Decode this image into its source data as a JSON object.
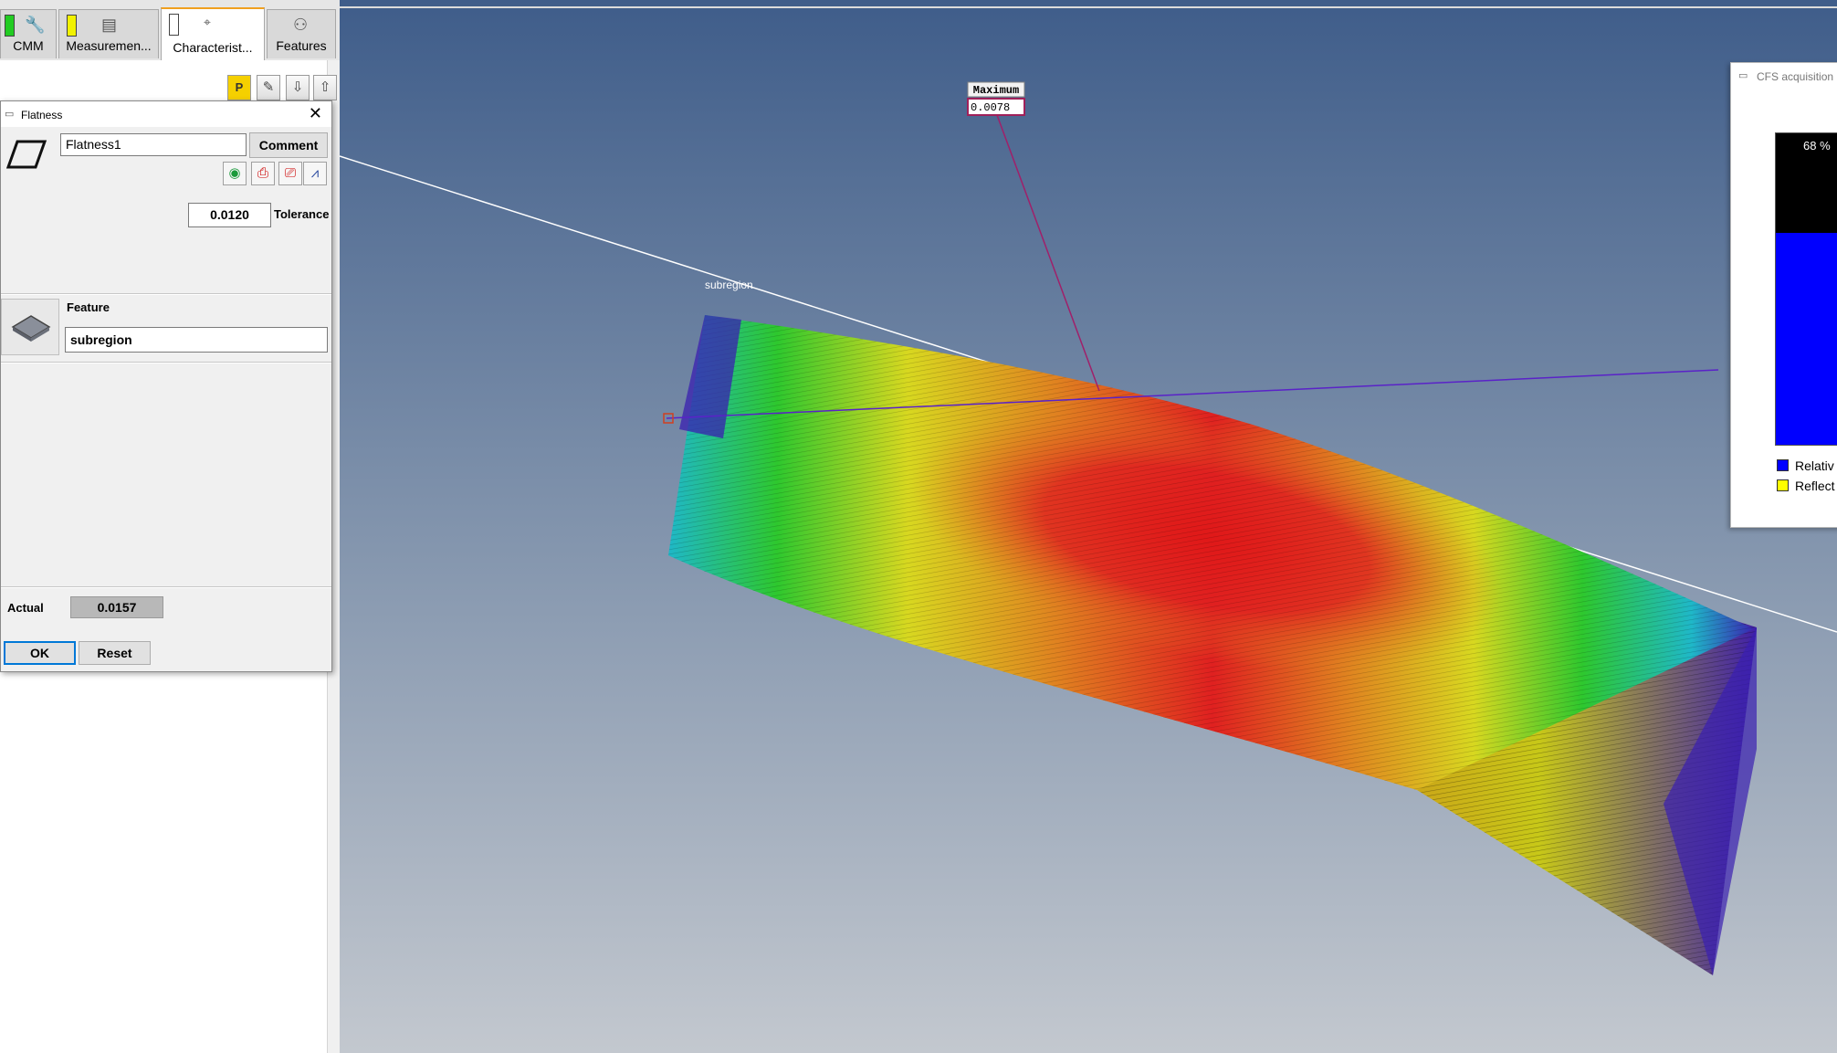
{
  "tabs": [
    {
      "label": "CMM",
      "indicator_color": "#22cc22",
      "icon": "wrench-icon"
    },
    {
      "label": "Measuremen...",
      "indicator_color": "#f2f200",
      "icon": "measurement-icon"
    },
    {
      "label": "Characterist...",
      "indicator_color": "#ffffff",
      "icon": "characteristic-icon",
      "active": true
    },
    {
      "label": "Features",
      "icon": "features-icon"
    }
  ],
  "toolbar": {
    "p_label": "P"
  },
  "dialog": {
    "title": "Flatness",
    "name_value": "Flatness1",
    "comment_label": "Comment",
    "tolerance_value": "0.0120",
    "tolerance_label": "Tolerance",
    "feature_heading": "Feature",
    "feature_value": "subregion",
    "actual_label": "Actual",
    "actual_value": "0.0157",
    "ok_label": "OK",
    "reset_label": "Reset"
  },
  "viewport": {
    "background_top": "#3f5d8a",
    "background_bottom": "#c0c6ce",
    "subregion_label": "subregion",
    "maximum_label": "Maximum",
    "maximum_value": "0.0078",
    "color_scale": [
      "#3a1fb0",
      "#1fb8c8",
      "#2ec82e",
      "#d8d820",
      "#e08020",
      "#e02020"
    ]
  },
  "cfs_panel": {
    "title": "CFS acquisition",
    "progress_text": "68 %",
    "progress_fraction": 0.68,
    "legend": [
      {
        "label": "Relativ",
        "color": "#0000ff"
      },
      {
        "label": "Reflect",
        "color": "#ffff00"
      }
    ]
  }
}
